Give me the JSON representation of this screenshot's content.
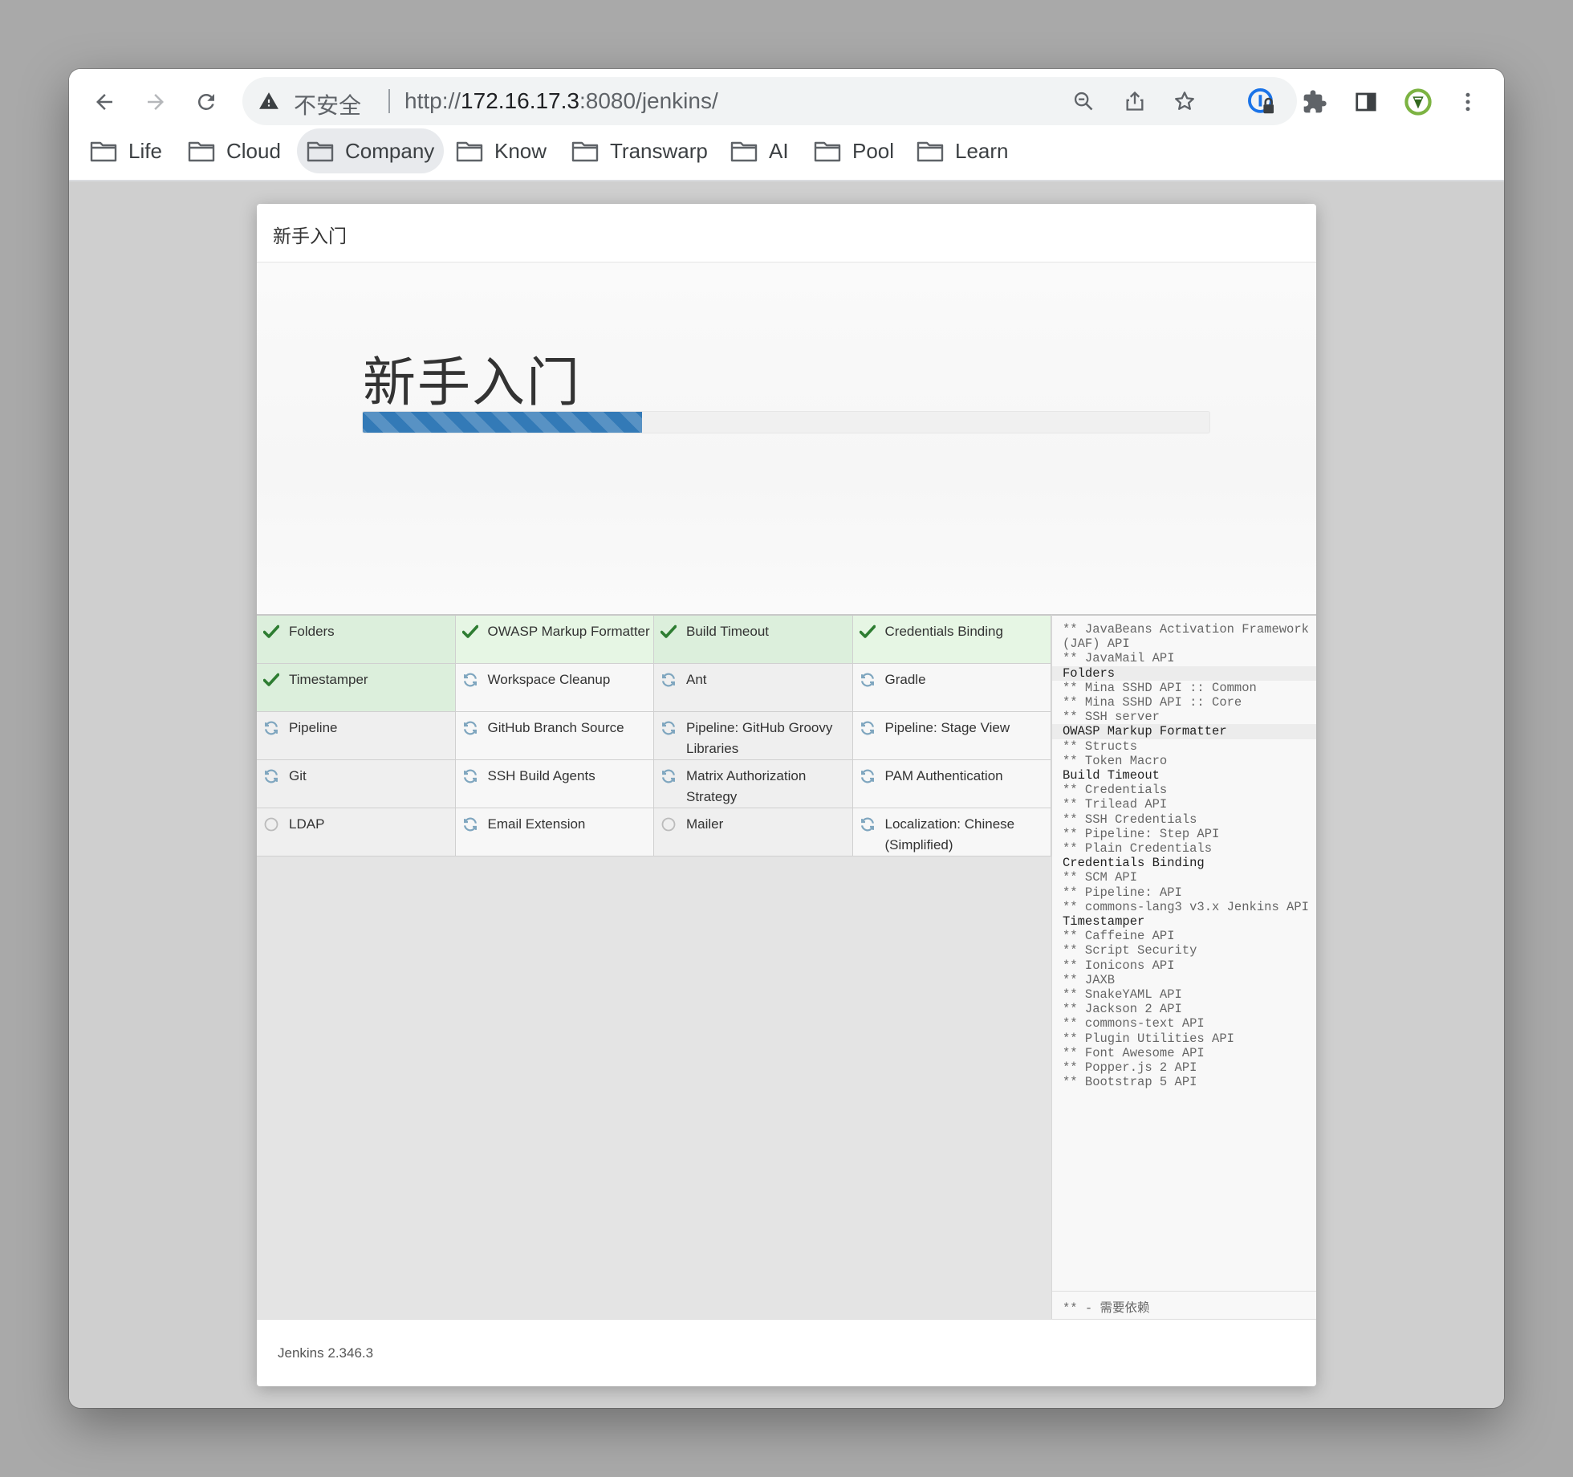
{
  "browser": {
    "security_label": "不安全",
    "url_prefix": "http://",
    "url_host": "172.16.17.3",
    "url_rest": ":8080/jenkins/",
    "bookmarks": [
      {
        "label": "Life"
      },
      {
        "label": "Cloud"
      },
      {
        "label": "Company"
      },
      {
        "label": "Know"
      },
      {
        "label": "Transwarp"
      },
      {
        "label": "AI"
      },
      {
        "label": "Pool"
      },
      {
        "label": "Learn"
      }
    ]
  },
  "modal": {
    "header_title": "新手入门",
    "hero_title": "新手入门",
    "progress_value": 0.33,
    "footer_version": "Jenkins 2.346.3"
  },
  "plugins": [
    {
      "name": "Folders",
      "status": "done"
    },
    {
      "name": "OWASP Markup Formatter",
      "status": "done"
    },
    {
      "name": "Build Timeout",
      "status": "done"
    },
    {
      "name": "Credentials Binding",
      "status": "done"
    },
    {
      "name": "Timestamper",
      "status": "done"
    },
    {
      "name": "Workspace Cleanup",
      "status": "installing"
    },
    {
      "name": "Ant",
      "status": "installing"
    },
    {
      "name": "Gradle",
      "status": "installing"
    },
    {
      "name": "Pipeline",
      "status": "installing"
    },
    {
      "name": "GitHub Branch Source",
      "status": "installing"
    },
    {
      "name": "Pipeline: GitHub Groovy Libraries",
      "status": "installing"
    },
    {
      "name": "Pipeline: Stage View",
      "status": "installing"
    },
    {
      "name": "Git",
      "status": "installing"
    },
    {
      "name": "SSH Build Agents",
      "status": "installing"
    },
    {
      "name": "Matrix Authorization Strategy",
      "status": "installing"
    },
    {
      "name": "PAM Authentication",
      "status": "installing"
    },
    {
      "name": "LDAP",
      "status": "pending"
    },
    {
      "name": "Email Extension",
      "status": "installing"
    },
    {
      "name": "Mailer",
      "status": "pending"
    },
    {
      "name": "Localization: Chinese (Simplified)",
      "status": "installing"
    }
  ],
  "log": {
    "lines": [
      {
        "text": "** JavaBeans Activation Framework (JAF) API",
        "kind": "dep"
      },
      {
        "text": "** JavaMail API",
        "kind": "dep"
      },
      {
        "text": "Folders",
        "kind": "plugin",
        "highlight": true
      },
      {
        "text": "** Mina SSHD API :: Common",
        "kind": "dep"
      },
      {
        "text": "** Mina SSHD API :: Core",
        "kind": "dep"
      },
      {
        "text": "** SSH server",
        "kind": "dep"
      },
      {
        "text": "OWASP Markup Formatter",
        "kind": "plugin",
        "highlight": true
      },
      {
        "text": "** Structs",
        "kind": "dep"
      },
      {
        "text": "** Token Macro",
        "kind": "dep"
      },
      {
        "text": "Build Timeout",
        "kind": "plugin"
      },
      {
        "text": "** Credentials",
        "kind": "dep"
      },
      {
        "text": "** Trilead API",
        "kind": "dep"
      },
      {
        "text": "** SSH Credentials",
        "kind": "dep"
      },
      {
        "text": "** Pipeline: Step API",
        "kind": "dep"
      },
      {
        "text": "** Plain Credentials",
        "kind": "dep"
      },
      {
        "text": "Credentials Binding",
        "kind": "plugin"
      },
      {
        "text": "** SCM API",
        "kind": "dep"
      },
      {
        "text": "** Pipeline: API",
        "kind": "dep"
      },
      {
        "text": "** commons-lang3 v3.x Jenkins API",
        "kind": "dep"
      },
      {
        "text": "Timestamper",
        "kind": "plugin"
      },
      {
        "text": "** Caffeine API",
        "kind": "dep"
      },
      {
        "text": "** Script Security",
        "kind": "dep"
      },
      {
        "text": "** Ionicons API",
        "kind": "dep"
      },
      {
        "text": "** JAXB",
        "kind": "dep"
      },
      {
        "text": "** SnakeYAML API",
        "kind": "dep"
      },
      {
        "text": "** Jackson 2 API",
        "kind": "dep"
      },
      {
        "text": "** commons-text API",
        "kind": "dep"
      },
      {
        "text": "** Plugin Utilities API",
        "kind": "dep"
      },
      {
        "text": "** Font Awesome API",
        "kind": "dep"
      },
      {
        "text": "** Popper.js 2 API",
        "kind": "dep"
      },
      {
        "text": "** Bootstrap 5 API",
        "kind": "dep"
      }
    ],
    "footer": "** - 需要依赖"
  },
  "icons": {
    "back": "back-arrow-icon",
    "forward": "forward-arrow-icon",
    "reload": "reload-icon",
    "warning": "warning-triangle-icon",
    "zoom": "zoom-icon",
    "share": "share-icon",
    "star": "bookmark-star-icon",
    "password_manager": "password-manager-icon",
    "extensions": "puzzle-icon",
    "side_panel": "side-panel-icon",
    "extension_shield": "green-shield-extension-icon",
    "menu": "kebab-menu-icon",
    "folder": "folder-icon",
    "done": "checkmark-icon",
    "installing": "refresh-icon",
    "pending": "circle-icon"
  },
  "colors": {
    "progress": "#337ab7",
    "done_check": "#2e7d32",
    "installing_icon": "#7fa6bf",
    "pending_icon": "#bbbbbb"
  }
}
